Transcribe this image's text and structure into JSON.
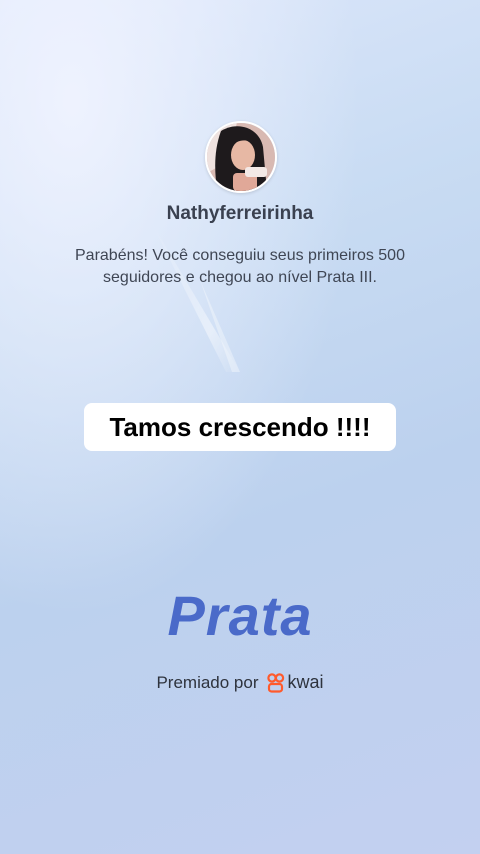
{
  "profile": {
    "username": "Nathyferreirinha"
  },
  "achievement": {
    "message": "Parabéns! Você conseguiu seus primeiros 500 seguidores e chegou ao nível Prata III.",
    "level_name": "Prata"
  },
  "caption": {
    "text": "Tamos crescendo !!!!"
  },
  "footer": {
    "awarded_by_label": "Premiado por",
    "brand_name": "kwai",
    "brand_icon": "kwai-logo-icon",
    "brand_color": "#ff5a2c"
  },
  "colors": {
    "level_text": "#4a6ac9",
    "background_top": "#dde7fb",
    "background_bottom": "#c3d0f0"
  }
}
